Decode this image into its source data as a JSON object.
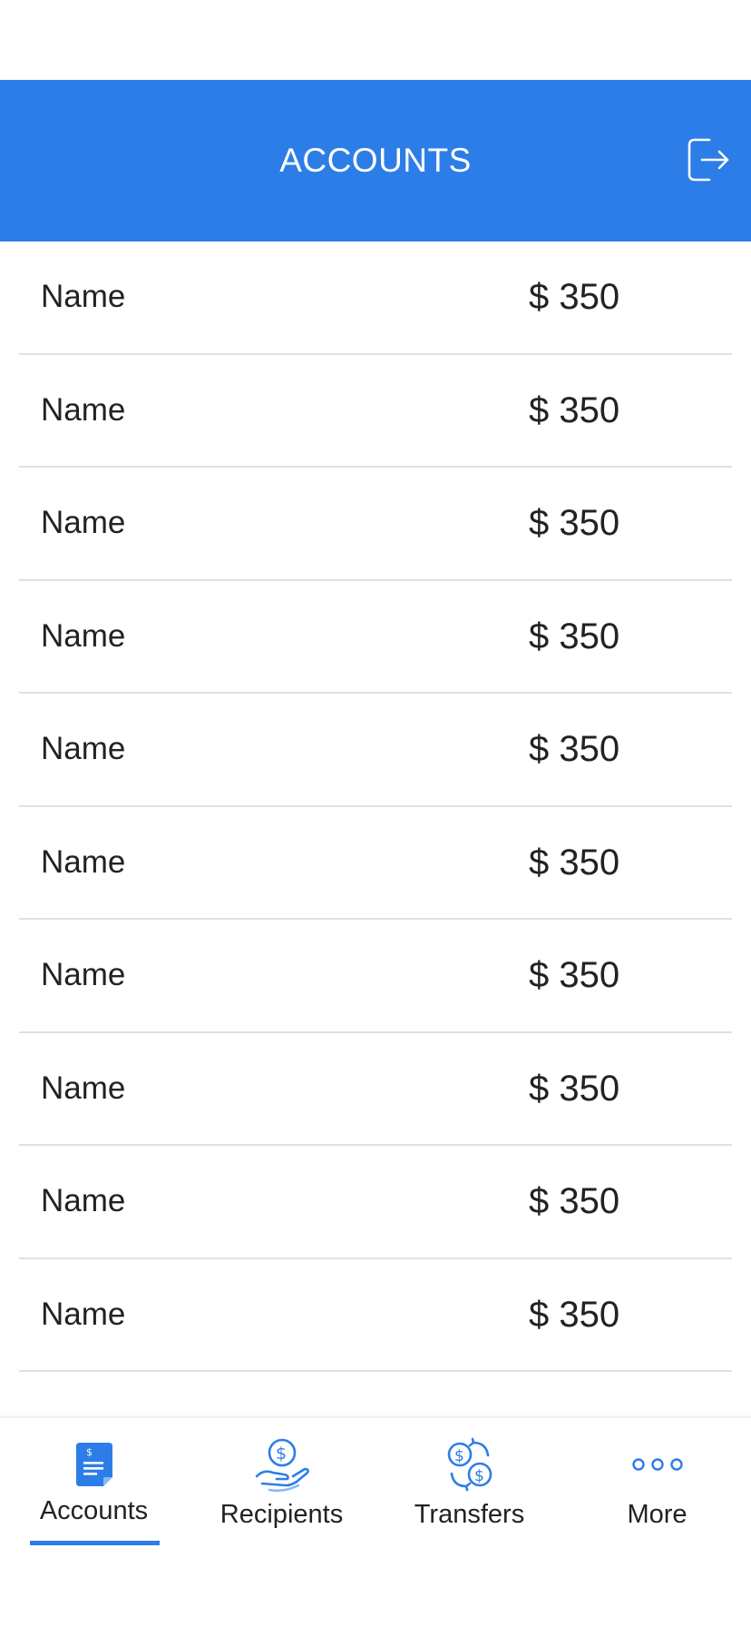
{
  "header": {
    "title": "ACCOUNTS",
    "logout_icon": "logout-icon"
  },
  "accounts": [
    {
      "name": "Name",
      "amount": "$ 350"
    },
    {
      "name": "Name",
      "amount": "$ 350"
    },
    {
      "name": "Name",
      "amount": "$ 350"
    },
    {
      "name": "Name",
      "amount": "$ 350"
    },
    {
      "name": "Name",
      "amount": "$ 350"
    },
    {
      "name": "Name",
      "amount": "$ 350"
    },
    {
      "name": "Name",
      "amount": "$ 350"
    },
    {
      "name": "Name",
      "amount": "$ 350"
    },
    {
      "name": "Name",
      "amount": "$ 350"
    },
    {
      "name": "Name",
      "amount": "$ 350"
    }
  ],
  "tabbar": {
    "active": "Accounts",
    "accent_color": "#2d7de8",
    "tabs": [
      {
        "label": "Accounts",
        "icon": "document-dollar-icon"
      },
      {
        "label": "Recipients",
        "icon": "hand-coin-icon"
      },
      {
        "label": "Transfers",
        "icon": "currency-exchange-icon"
      },
      {
        "label": "More",
        "icon": "more-dots-icon"
      }
    ]
  }
}
